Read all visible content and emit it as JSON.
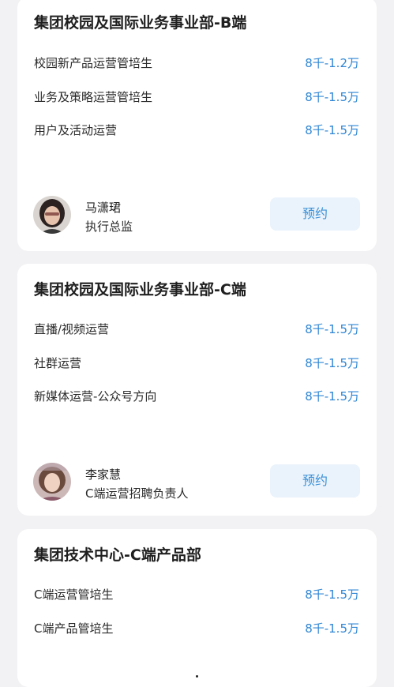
{
  "cards": [
    {
      "title": "集团校园及国际业务事业部-B端",
      "jobs": [
        {
          "name": "校园新产品运营管培生",
          "salary": "8千-1.2万"
        },
        {
          "name": "业务及策略运营管培生",
          "salary": "8千-1.5万"
        },
        {
          "name": "用户及活动运营",
          "salary": "8千-1.5万"
        }
      ],
      "recruiter": {
        "name": "马潇珺",
        "title": "执行总监",
        "button": "预约"
      }
    },
    {
      "title": "集团校园及国际业务事业部-C端",
      "jobs": [
        {
          "name": "直播/视频运营",
          "salary": "8千-1.5万"
        },
        {
          "name": "社群运营",
          "salary": "8千-1.5万"
        },
        {
          "name": "新媒体运营-公众号方向",
          "salary": "8千-1.5万"
        }
      ],
      "recruiter": {
        "name": "李家慧",
        "title": "C端运营招聘负责人",
        "button": "预约"
      }
    },
    {
      "title": "集团技术中心-C端产品部",
      "jobs": [
        {
          "name": "C端运营管培生",
          "salary": "8千-1.5万"
        },
        {
          "name": "C端产品管培生",
          "salary": "8千-1.5万"
        }
      ]
    }
  ],
  "colors": {
    "accent": "#2f86d4",
    "button_bg": "#eaf3fb",
    "page_bg": "#f2f2f4"
  }
}
